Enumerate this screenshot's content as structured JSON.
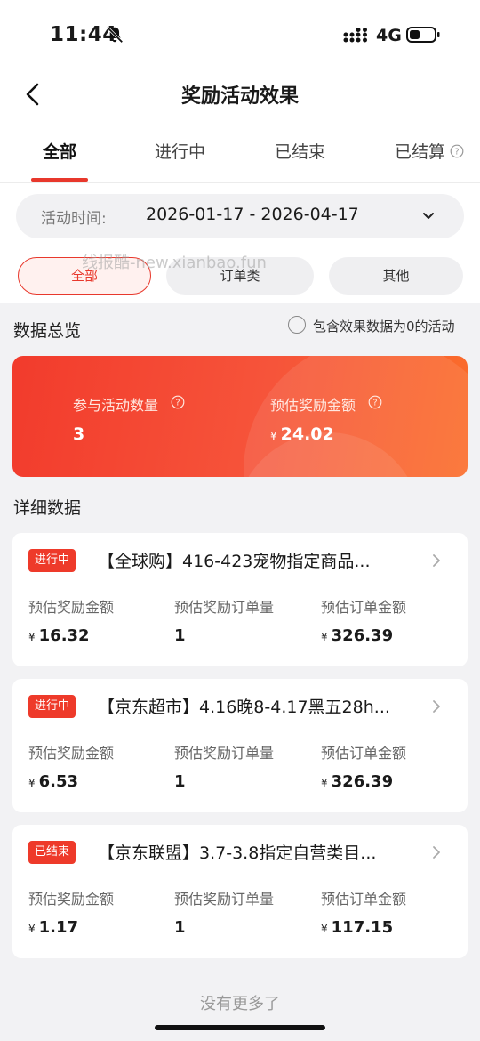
{
  "status_bar": {
    "time": "11:44",
    "network": "4G"
  },
  "nav": {
    "title": "奖励活动效果"
  },
  "tabs": [
    {
      "label": "全部",
      "active": true
    },
    {
      "label": "进行中",
      "active": false
    },
    {
      "label": "已结束",
      "active": false
    },
    {
      "label": "已结算",
      "active": false
    }
  ],
  "filter": {
    "date_label": "活动时间:",
    "date_range": "2026-01-17 - 2026-04-17",
    "chips": [
      {
        "label": "全部",
        "active": true
      },
      {
        "label": "订单类",
        "active": false
      },
      {
        "label": "其他",
        "active": false
      }
    ],
    "watermark": "线报酷-new.xianbao.fun"
  },
  "overview": {
    "title": "数据总览",
    "include_zero_label": "包含效果数据为0的活动",
    "include_zero_checked": false,
    "activity_count_label": "参与活动数量",
    "activity_count": "3",
    "reward_label": "预估奖励金额",
    "currency": "¥",
    "reward_amount": "24.02"
  },
  "details": {
    "title": "详细数据",
    "metric_labels": [
      "预估奖励金额",
      "预估奖励订单量",
      "预估订单金额"
    ],
    "currency": "¥",
    "items": [
      {
        "status": "进行中",
        "title": "【全球购】416-423宠物指定商品...",
        "reward": "16.32",
        "orders": "1",
        "order_amount": "326.39"
      },
      {
        "status": "进行中",
        "title": "【京东超市】4.16晚8-4.17黑五28h...",
        "reward": "6.53",
        "orders": "1",
        "order_amount": "326.39"
      },
      {
        "status": "已结束",
        "title": "【京东联盟】3.7-3.8指定自营类目...",
        "reward": "1.17",
        "orders": "1",
        "order_amount": "117.15"
      }
    ]
  },
  "footer": {
    "text": "没有更多了"
  },
  "colors": {
    "accent": "#e8382c",
    "card_gradient_start": "#f23b2c",
    "card_gradient_end": "#fb6d2a"
  }
}
